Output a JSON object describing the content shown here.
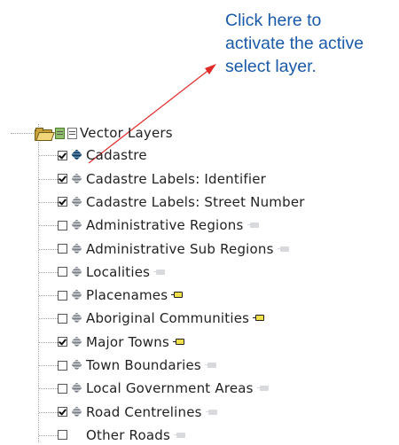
{
  "callout": {
    "lines": [
      "Click here to",
      "activate the active",
      "select layer."
    ],
    "color": "#1a5aa8",
    "arrow_color": "#e02a2a"
  },
  "tree": {
    "root": {
      "label": "Vector Layers",
      "icon": "folder-open-icon"
    },
    "layers": [
      {
        "label": "Cadastre",
        "checked": true,
        "icon": "layer-active-icon",
        "tag": null
      },
      {
        "label": "Cadastre Labels: Identifier",
        "checked": true,
        "icon": "layer-icon",
        "tag": null
      },
      {
        "label": "Cadastre Labels: Street Number",
        "checked": true,
        "icon": "layer-icon",
        "tag": null
      },
      {
        "label": "Administrative Regions",
        "checked": false,
        "icon": "layer-icon",
        "tag": "grey"
      },
      {
        "label": "Administrative Sub Regions",
        "checked": false,
        "icon": "layer-icon",
        "tag": "grey"
      },
      {
        "label": "Localities",
        "checked": false,
        "icon": "layer-icon",
        "tag": "grey"
      },
      {
        "label": "Placenames",
        "checked": false,
        "icon": "layer-icon",
        "tag": "yellow"
      },
      {
        "label": "Aboriginal Communities",
        "checked": false,
        "icon": "layer-icon",
        "tag": "yellow"
      },
      {
        "label": "Major Towns",
        "checked": true,
        "icon": "layer-icon",
        "tag": "yellow"
      },
      {
        "label": "Town Boundaries",
        "checked": false,
        "icon": "layer-icon",
        "tag": "grey"
      },
      {
        "label": "Local Government Areas",
        "checked": false,
        "icon": "layer-icon",
        "tag": "grey"
      },
      {
        "label": "Road Centrelines",
        "checked": true,
        "icon": "layer-icon",
        "tag": "grey"
      },
      {
        "label": "Other Roads",
        "checked": false,
        "icon": "no-icon",
        "tag": "grey"
      }
    ]
  }
}
